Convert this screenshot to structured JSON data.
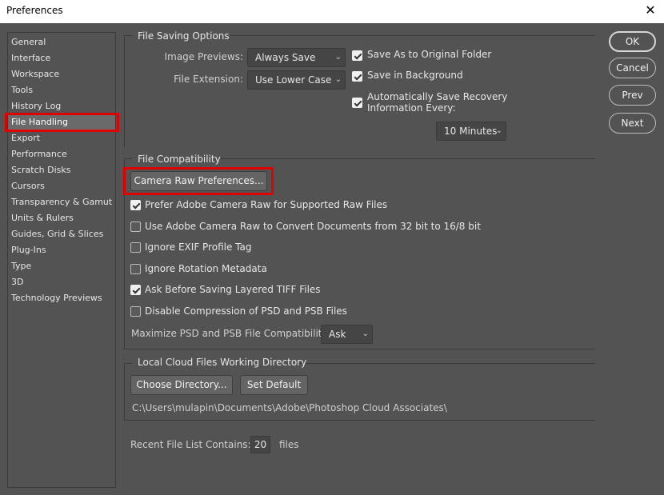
{
  "window": {
    "title": "Preferences",
    "close_glyph": "✕"
  },
  "nav": {
    "items": [
      {
        "label": "General"
      },
      {
        "label": "Interface"
      },
      {
        "label": "Workspace"
      },
      {
        "label": "Tools"
      },
      {
        "label": "History Log"
      },
      {
        "label": "File Handling",
        "selected": true
      },
      {
        "label": "Export"
      },
      {
        "label": "Performance"
      },
      {
        "label": "Scratch Disks"
      },
      {
        "label": "Cursors"
      },
      {
        "label": "Transparency & Gamut"
      },
      {
        "label": "Units & Rulers"
      },
      {
        "label": "Guides, Grid & Slices"
      },
      {
        "label": "Plug-Ins"
      },
      {
        "label": "Type"
      },
      {
        "label": "3D"
      },
      {
        "label": "Technology Previews"
      }
    ]
  },
  "file_saving": {
    "title": "File Saving Options",
    "image_previews_label": "Image Previews:",
    "image_previews_value": "Always Save",
    "file_extension_label": "File Extension:",
    "file_extension_value": "Use Lower Case",
    "save_as_original": {
      "label": "Save As to Original Folder",
      "checked": true
    },
    "save_background": {
      "label": "Save in Background",
      "checked": true
    },
    "auto_save_line1": "Automatically Save Recovery",
    "auto_save_line2": "Information Every:",
    "auto_save_checked": true,
    "interval_value": "10 Minutes"
  },
  "compat": {
    "title": "File Compatibility",
    "camera_raw_button": "Camera Raw Preferences...",
    "options": [
      {
        "label": "Prefer Adobe Camera Raw for Supported Raw Files",
        "checked": true
      },
      {
        "label": "Use Adobe Camera Raw to Convert Documents from 32 bit to 16/8 bit",
        "checked": false
      },
      {
        "label": "Ignore EXIF Profile Tag",
        "checked": false
      },
      {
        "label": "Ignore Rotation Metadata",
        "checked": false
      },
      {
        "label": "Ask Before Saving Layered TIFF Files",
        "checked": true
      },
      {
        "label": "Disable Compression of PSD and PSB Files",
        "checked": false
      }
    ],
    "maximize_label": "Maximize PSD and PSB File Compatibility:",
    "maximize_value": "Ask"
  },
  "cloud": {
    "title": "Local Cloud Files Working Directory",
    "choose_button": "Choose Directory...",
    "default_button": "Set Default",
    "path": "C:\\Users\\mulapin\\Documents\\Adobe\\Photoshop Cloud Associates\\"
  },
  "recent": {
    "label": "Recent File List Contains:",
    "value": "20",
    "suffix": "files"
  },
  "buttons": {
    "ok": "OK",
    "cancel": "Cancel",
    "prev": "Prev",
    "next": "Next"
  },
  "chevron_glyph": "⌄",
  "colors": {
    "highlight": "#e00000",
    "panel": "#535353"
  }
}
